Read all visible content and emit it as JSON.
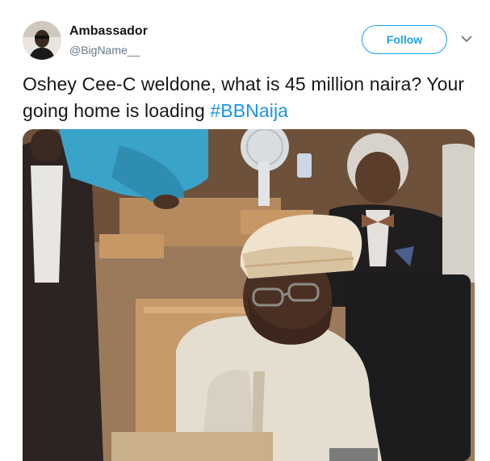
{
  "tweet": {
    "author": {
      "display_name": "Ambassador",
      "handle": "@BigName__",
      "avatar_icon": "user-avatar"
    },
    "follow_label": "Follow",
    "more_icon": "chevron-down-icon",
    "text_main": "Oshey Cee-C weldone, what is 45 million naira? Your going home is loading ",
    "hashtag": "#BBNaija",
    "media_description_icon": "photo"
  },
  "colors": {
    "accent": "#1da1f2",
    "hashtag": "#1b95e0",
    "text": "#14171a",
    "secondary_text": "#657786"
  }
}
